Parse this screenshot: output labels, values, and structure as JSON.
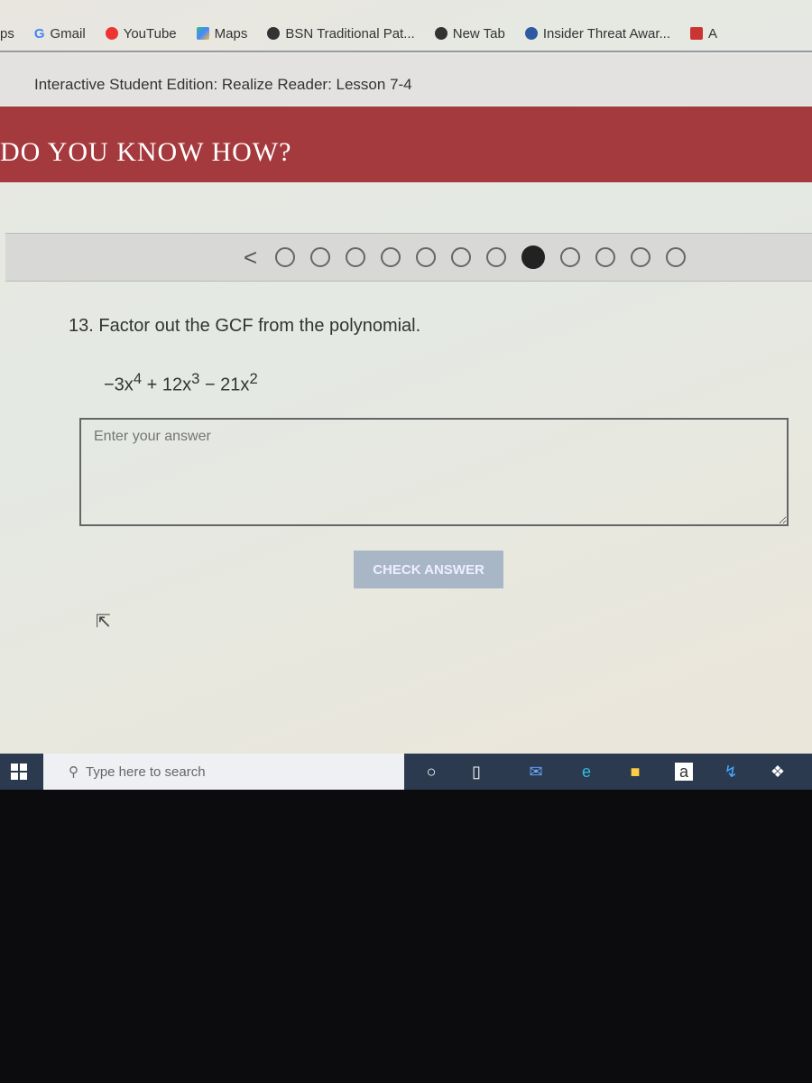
{
  "bookmarks": [
    {
      "label": "ps",
      "icon": "apps-icon"
    },
    {
      "label": "Gmail",
      "icon": "google-icon"
    },
    {
      "label": "YouTube",
      "icon": "youtube-icon"
    },
    {
      "label": "Maps",
      "icon": "maps-icon"
    },
    {
      "label": "BSN Traditional Pat...",
      "icon": "globe-icon"
    },
    {
      "label": "New Tab",
      "icon": "globe-icon"
    },
    {
      "label": "Insider Threat Awar...",
      "icon": "site-icon"
    },
    {
      "label": "A",
      "icon": "c-icon"
    }
  ],
  "page_title": "Interactive Student Edition: Realize Reader: Lesson 7-4",
  "banner_title": "DO YOU KNOW HOW?",
  "pagination": {
    "total": 12,
    "current": 8
  },
  "question": "13. Factor out the GCF from the polynomial.",
  "expression": {
    "t1": "−3x",
    "e1": "4",
    "t2": " + 12x",
    "e2": "3",
    "t3": " − 21x",
    "e3": "2"
  },
  "answer": {
    "value": "",
    "placeholder": "Enter your answer"
  },
  "check_button": "CHECK ANSWER",
  "taskbar": {
    "search_placeholder": "Type here to search"
  }
}
